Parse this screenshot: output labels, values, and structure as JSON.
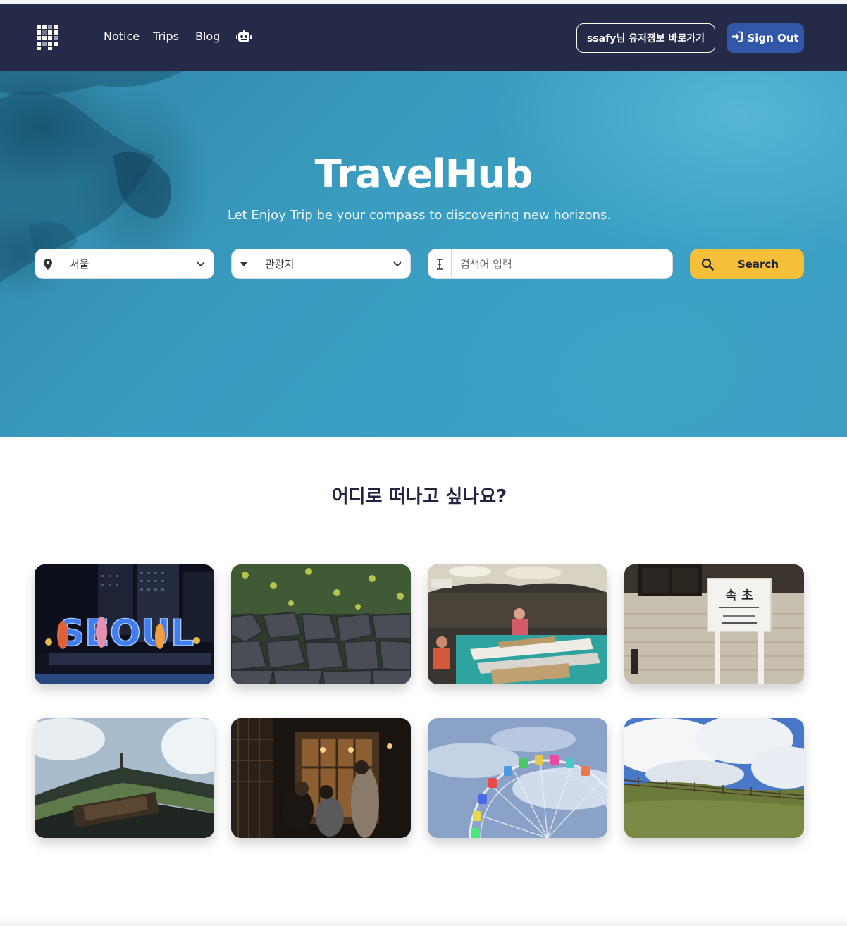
{
  "nav": {
    "links": [
      "Notice",
      "Trips",
      "Blog"
    ],
    "bot_icon": "robot-icon",
    "profile_button": "ssafy님 유저정보 바로가기",
    "signout_button": "Sign Out",
    "signout_icon": "sign-in-arrow-icon"
  },
  "hero": {
    "title": "TravelHub",
    "subtitle": "Let Enjoy Trip be your compass to discovering new horizons.",
    "region_select": {
      "icon": "map-pin-icon",
      "value": "서울"
    },
    "category_select": {
      "icon": "caret-down-icon",
      "value": "관광지"
    },
    "search_input": {
      "icon": "text-cursor-icon",
      "placeholder": "검색어 입력",
      "value": ""
    },
    "search_button": {
      "icon": "search-icon",
      "label": "Search"
    }
  },
  "destinations": {
    "title": "어디로 떠나고 싶나요?",
    "cards": [
      {
        "scene": "seoul-night-sign",
        "sign_text": "SEOUL"
      },
      {
        "scene": "jeju-stone-wall-tangerines"
      },
      {
        "scene": "fish-market"
      },
      {
        "scene": "sokcho-station-sign",
        "sign_text": "속 초"
      },
      {
        "scene": "palace-gate-roof"
      },
      {
        "scene": "night-alley-shop"
      },
      {
        "scene": "ferris-wheel"
      },
      {
        "scene": "grassy-hill-fence"
      }
    ]
  },
  "colors": {
    "nav_bg": "#242a48",
    "signout_bg": "#3357a8",
    "search_bg": "#f6bf3a",
    "hero_blue": "#3a9cbf",
    "heading": "#1f2440"
  }
}
